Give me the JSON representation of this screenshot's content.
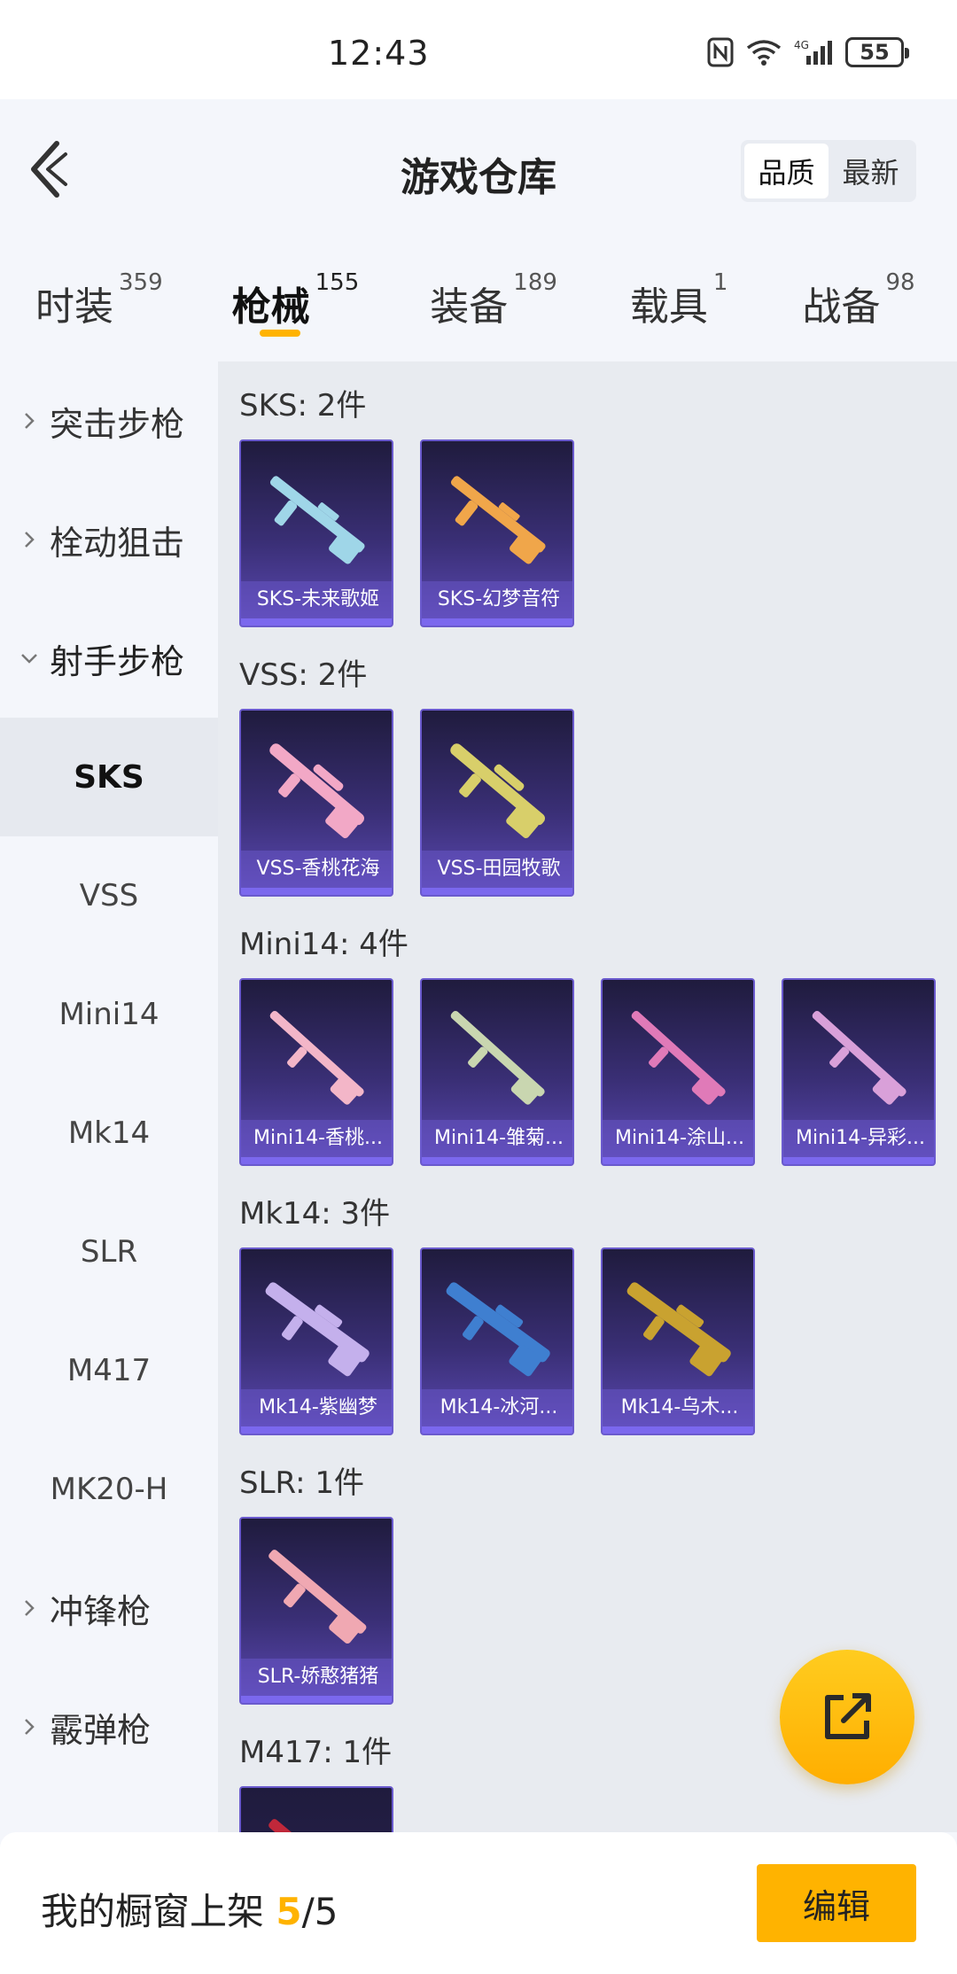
{
  "status_bar": {
    "time": "12:43",
    "battery": "55",
    "network": "4G"
  },
  "header": {
    "title": "游戏仓库",
    "sort_options": [
      "品质",
      "最新"
    ],
    "sort_active": 0
  },
  "tabs": [
    {
      "label": "时装",
      "count": "359"
    },
    {
      "label": "枪械",
      "count": "155"
    },
    {
      "label": "装备",
      "count": "189"
    },
    {
      "label": "载具",
      "count": "1"
    },
    {
      "label": "战备",
      "count": "98"
    }
  ],
  "active_tab": 1,
  "sidebar": {
    "categories": [
      {
        "label": "突击步枪",
        "expanded": false
      },
      {
        "label": "栓动狙击",
        "expanded": false
      },
      {
        "label": "射手步枪",
        "expanded": true
      },
      {
        "label": "冲锋枪",
        "expanded": false
      },
      {
        "label": "霰弹枪",
        "expanded": false
      }
    ],
    "subitems": [
      "SKS",
      "VSS",
      "Mini14",
      "Mk14",
      "SLR",
      "M417",
      "MK20-H"
    ],
    "selected_subitem": "SKS"
  },
  "groups": [
    {
      "title": "SKS: 2件",
      "items": [
        {
          "name": "SKS-未来歌姬",
          "color": "#9fd6e8"
        },
        {
          "name": "SKS-幻梦音符",
          "color": "#f0a64a"
        }
      ]
    },
    {
      "title": "VSS: 2件",
      "items": [
        {
          "name": "VSS-香桃花海",
          "color": "#f2a8c6"
        },
        {
          "name": "VSS-田园牧歌",
          "color": "#d8cf6a"
        }
      ]
    },
    {
      "title": "Mini14: 4件",
      "items": [
        {
          "name": "Mini14-香桃...",
          "color": "#f3b6c8"
        },
        {
          "name": "Mini14-雏菊...",
          "color": "#c9d6b0"
        },
        {
          "name": "Mini14-涂山...",
          "color": "#e07ab8"
        },
        {
          "name": "Mini14-异彩...",
          "color": "#d9a0d9"
        }
      ]
    },
    {
      "title": "Mk14: 3件",
      "items": [
        {
          "name": "Mk14-紫幽梦",
          "color": "#c4b0ec"
        },
        {
          "name": "Mk14-冰河...",
          "color": "#3f7fd0"
        },
        {
          "name": "Mk14-乌木...",
          "color": "#c9a230"
        }
      ]
    },
    {
      "title": "SLR: 1件",
      "items": [
        {
          "name": "SLR-娇憨猪猪",
          "color": "#f0a8b2"
        }
      ]
    },
    {
      "title": "M417: 1件",
      "items": []
    }
  ],
  "bottom": {
    "showcase_label": "我的橱窗上架",
    "showcase_current": "5",
    "showcase_sep": "/",
    "showcase_total": "5",
    "edit_label": "编辑"
  },
  "icons": {
    "back": "back-chevron-icon",
    "fab": "share-external-icon"
  },
  "colors": {
    "accent": "#ffb300",
    "card_top": "#1f1b3d",
    "card_bottom": "#5b49b3"
  }
}
